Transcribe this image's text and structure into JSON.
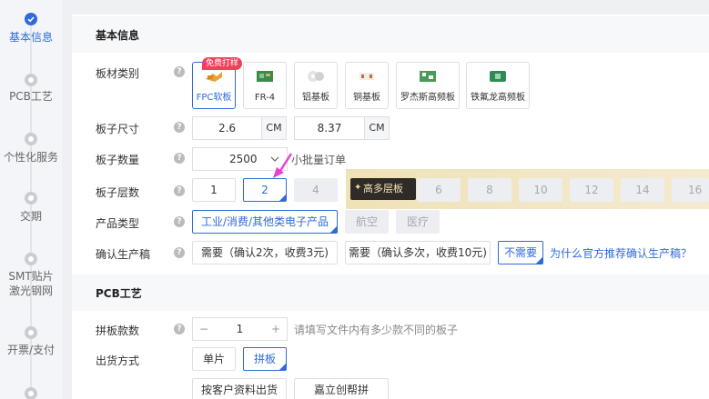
{
  "steps": [
    {
      "label": "基本信息",
      "active": true
    },
    {
      "label": "PCB工艺"
    },
    {
      "label": "个性化服务"
    },
    {
      "label": "交期"
    },
    {
      "label": "SMT贴片",
      "label2": "激光钢网"
    },
    {
      "label": "开票/支付"
    }
  ],
  "basic": {
    "title": "基本信息",
    "material": {
      "label": "板材类别",
      "badge": "免费打样",
      "options": [
        "FPC软板",
        "FR-4",
        "铝基板",
        "铜基板",
        "罗杰斯高频板",
        "铁氟龙高频板"
      ]
    },
    "size": {
      "label": "板子尺寸",
      "width": "2.6",
      "height": "8.37",
      "unit": "CM"
    },
    "qty": {
      "label": "板子数量",
      "value": "2500",
      "hint": "小批量订单"
    },
    "layers": {
      "label": "板子层数",
      "options": [
        "1",
        "2",
        "4"
      ],
      "more_label": "高多层板",
      "more": [
        "6",
        "8",
        "10",
        "12",
        "14",
        "16"
      ]
    },
    "product": {
      "label": "产品类型",
      "options": [
        "工业/消费/其他类电子产品",
        "航空",
        "医疗"
      ]
    },
    "confirm": {
      "label": "确认生产稿",
      "options": [
        "需要（确认2次，收费3元)",
        "需要（确认多次，收费10元)",
        "不需要"
      ],
      "link": "为什么官方推荐确认生产稿？"
    }
  },
  "pcb": {
    "title": "PCB工艺",
    "panel_count": {
      "label": "拼板款数",
      "minus": "−",
      "value": "1",
      "plus": "+",
      "hint": "请填写文件内有多少款不同的板子"
    },
    "ship": {
      "label": "出货方式",
      "options": [
        "单片",
        "拼板"
      ],
      "sub": [
        "按客户资料出货",
        "嘉立创帮拼"
      ]
    }
  },
  "colors": {
    "accent": "#2f6ad9",
    "badge": "#f0405a",
    "arrow": "#e83fd3"
  }
}
